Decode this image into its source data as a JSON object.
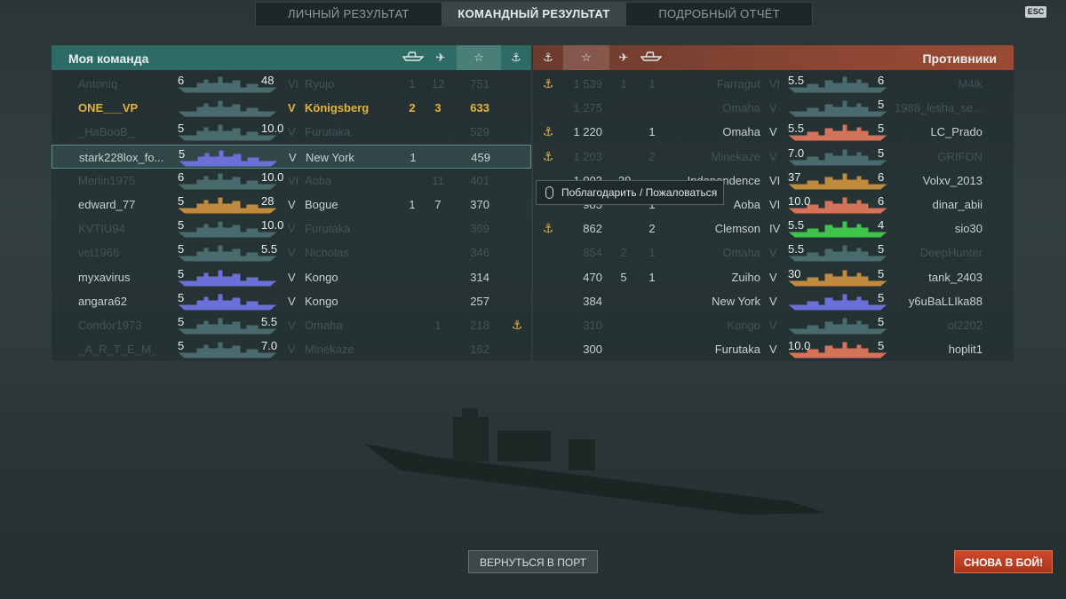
{
  "tabs": [
    "ЛИЧНЫЙ РЕЗУЛЬТАТ",
    "КОМАНДНЫЙ РЕЗУЛЬТАТ",
    "ПОДРОБНЫЙ ОТЧЁТ"
  ],
  "active_tab": 1,
  "esc_label": "ESC",
  "my_team": {
    "title": "Моя команда",
    "columns": [
      "ships-destroyed-icon",
      "planes-destroyed-icon",
      "star-icon",
      "anchor-icon"
    ],
    "rows": [
      {
        "name": "Antoniq",
        "tier": "VI",
        "ship": "Ryujo",
        "kills": "1",
        "planes": "12",
        "xp": "751",
        "anchor": "",
        "exp_left": "6",
        "exp_right": "48",
        "color": "dim",
        "sil_color": "#4a6b6e"
      },
      {
        "name": "ONE___VP",
        "tier": "V",
        "ship": "Königsberg",
        "kills": "2",
        "planes": "3",
        "xp": "633",
        "anchor": "",
        "exp_left": "",
        "exp_right": "",
        "color": "gold",
        "sil_color": "#4a6b6e"
      },
      {
        "name": "_HaBooB_",
        "tier": "V",
        "ship": "Furutaka",
        "kills": "",
        "planes": "",
        "xp": "529",
        "anchor": "",
        "exp_left": "5",
        "exp_right": "10.0",
        "color": "dim",
        "sil_color": "#4a6b6e"
      },
      {
        "name": "stark228lox_fo...",
        "tier": "V",
        "ship": "New York",
        "kills": "1",
        "planes": "",
        "xp": "459",
        "anchor": "",
        "exp_left": "5",
        "exp_right": "",
        "color": "normal",
        "sil_color": "#6b6fd8"
      },
      {
        "name": "Merlin1975",
        "tier": "VI",
        "ship": "Aoba",
        "kills": "",
        "planes": "11",
        "xp": "401",
        "anchor": "",
        "exp_left": "6",
        "exp_right": "10.0",
        "color": "dim",
        "sil_color": "#4a6b6e"
      },
      {
        "name": "edward_77",
        "tier": "V",
        "ship": "Bogue",
        "kills": "1",
        "planes": "7",
        "xp": "370",
        "anchor": "",
        "exp_left": "5",
        "exp_right": "28",
        "color": "normal",
        "sil_color": "#c08a3e"
      },
      {
        "name": "KVTIU94",
        "tier": "V",
        "ship": "Furutaka",
        "kills": "",
        "planes": "",
        "xp": "369",
        "anchor": "",
        "exp_left": "5",
        "exp_right": "10.0",
        "color": "dim",
        "sil_color": "#4a6b6e"
      },
      {
        "name": "vet1966",
        "tier": "V",
        "ship": "Nicholas",
        "kills": "",
        "planes": "",
        "xp": "346",
        "anchor": "",
        "exp_left": "5",
        "exp_right": "5.5",
        "color": "dim",
        "sil_color": "#4a6b6e"
      },
      {
        "name": "myxavirus",
        "tier": "V",
        "ship": "Kongo",
        "kills": "",
        "planes": "",
        "xp": "314",
        "anchor": "",
        "exp_left": "5",
        "exp_right": "",
        "color": "normal",
        "sil_color": "#6b6fd8"
      },
      {
        "name": "angara62",
        "tier": "V",
        "ship": "Kongo",
        "kills": "",
        "planes": "",
        "xp": "257",
        "anchor": "",
        "exp_left": "5",
        "exp_right": "",
        "color": "normal",
        "sil_color": "#6b6fd8"
      },
      {
        "name": "Condor1973",
        "tier": "V",
        "ship": "Omaha",
        "kills": "",
        "planes": "1",
        "xp": "218",
        "anchor": "⚓",
        "exp_left": "5",
        "exp_right": "5.5",
        "color": "dim",
        "sil_color": "#4a6b6e"
      },
      {
        "name": "_A_R_T_E_M_",
        "tier": "V",
        "ship": "Minekaze",
        "kills": "",
        "planes": "",
        "xp": "162",
        "anchor": "",
        "exp_left": "5",
        "exp_right": "7.0",
        "color": "dim",
        "sil_color": "#4a6b6e"
      }
    ]
  },
  "enemy_team": {
    "title": "Противники",
    "columns": [
      "anchor-icon",
      "star-icon",
      "planes-destroyed-icon",
      "ships-destroyed-icon"
    ],
    "rows": [
      {
        "name": "M4ik",
        "tier": "VI",
        "ship": "Farragut",
        "kills": "1",
        "planes": "1",
        "xp": "1 539",
        "anchor": "⚓",
        "exp_left": "5.5",
        "exp_right": "6",
        "color": "dim",
        "sil_color": "#4a6b6e"
      },
      {
        "name": "1988_lesha_se...",
        "tier": "V",
        "ship": "Omaha",
        "kills": "",
        "planes": "",
        "xp": "1 275",
        "anchor": "",
        "exp_left": "",
        "exp_right": "5",
        "color": "dim",
        "sil_color": "#4a6b6e"
      },
      {
        "name": "LC_Prado",
        "tier": "V",
        "ship": "Omaha",
        "kills": "1",
        "planes": "",
        "xp": "1 220",
        "anchor": "⚓",
        "exp_left": "5.5",
        "exp_right": "5",
        "color": "normal",
        "sil_color": "#d5735a"
      },
      {
        "name": "GRIFON",
        "tier": "V",
        "ship": "Minekaze",
        "kills": "2",
        "planes": "",
        "xp": "1 203",
        "anchor": "⚓",
        "exp_left": "7.0",
        "exp_right": "5",
        "color": "dim",
        "sil_color": "#4a6b6e"
      },
      {
        "name": "Volxv_2013",
        "tier": "VI",
        "ship": "Independence",
        "kills": "",
        "planes": "39",
        "xp": "1 003",
        "anchor": "",
        "exp_left": "37",
        "exp_right": "6",
        "color": "normal",
        "sil_color": "#c08a3e"
      },
      {
        "name": "dinar_abii",
        "tier": "VI",
        "ship": "Aoba",
        "kills": "1",
        "planes": "",
        "xp": "985",
        "anchor": "",
        "exp_left": "10.0",
        "exp_right": "6",
        "color": "normal",
        "sil_color": "#d5735a"
      },
      {
        "name": "sio30",
        "tier": "IV",
        "ship": "Clemson",
        "kills": "2",
        "planes": "",
        "xp": "862",
        "anchor": "⚓",
        "exp_left": "5.5",
        "exp_right": "4",
        "color": "normal",
        "sil_color": "#3ec44a"
      },
      {
        "name": "DeepHunter",
        "tier": "V",
        "ship": "Omaha",
        "kills": "1",
        "planes": "2",
        "xp": "854",
        "anchor": "",
        "exp_left": "5.5",
        "exp_right": "5",
        "color": "dim",
        "sil_color": "#4a6b6e"
      },
      {
        "name": "tank_2403",
        "tier": "V",
        "ship": "Zuiho",
        "kills": "1",
        "planes": "5",
        "xp": "470",
        "anchor": "",
        "exp_left": "30",
        "exp_right": "5",
        "color": "normal",
        "sil_color": "#c08a3e"
      },
      {
        "name": "y6uBaLLIka88",
        "tier": "V",
        "ship": "New York",
        "kills": "",
        "planes": "",
        "xp": "384",
        "anchor": "",
        "exp_left": "",
        "exp_right": "5",
        "color": "normal",
        "sil_color": "#6b6fd8"
      },
      {
        "name": "ol2202",
        "tier": "V",
        "ship": "Kongo",
        "kills": "",
        "planes": "",
        "xp": "310",
        "anchor": "",
        "exp_left": "",
        "exp_right": "5",
        "color": "dim",
        "sil_color": "#4a6b6e"
      },
      {
        "name": "hoplit1",
        "tier": "V",
        "ship": "Furutaka",
        "kills": "",
        "planes": "",
        "xp": "300",
        "anchor": "",
        "exp_left": "10.0",
        "exp_right": "5",
        "color": "normal",
        "sil_color": "#d5735a"
      }
    ]
  },
  "tooltip": "Поблагодарить / Пожаловаться",
  "buttons": {
    "port": "ВЕРНУТЬСЯ В ПОРТ",
    "battle": "СНОВА В БОЙ!"
  },
  "highlight_row": 3
}
